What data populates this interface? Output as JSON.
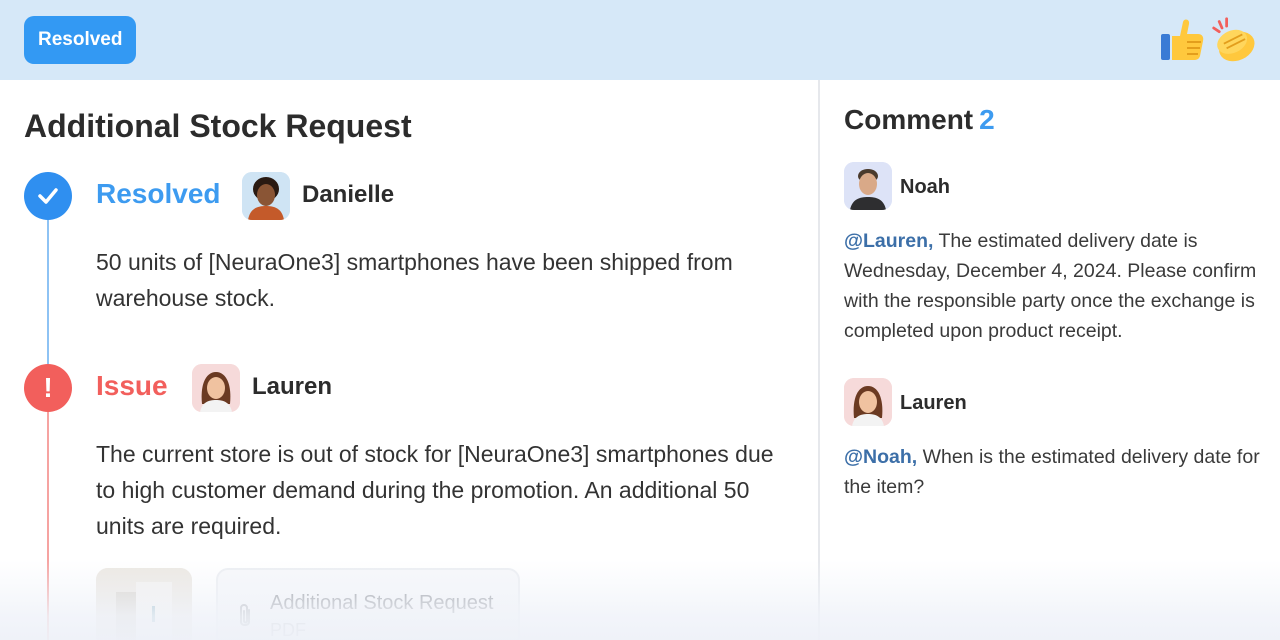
{
  "header": {
    "status_badge": "Resolved",
    "reactions": [
      "thumbs-up-icon",
      "clapping-hands-icon"
    ]
  },
  "request": {
    "title": "Additional Stock Request",
    "steps": [
      {
        "status": "Resolved",
        "user": "Danielle",
        "text": "50 units of [NeuraOne3] smartphones have been shipped from warehouse stock."
      },
      {
        "status": "Issue",
        "user": "Lauren",
        "text": "The current store is out of stock for [NeuraOne3] smartphones due to high customer demand during the promotion. An additional 50 units are required."
      }
    ],
    "attachment": {
      "name": "Additional Stock Request",
      "type": "PDF"
    }
  },
  "comments": {
    "label": "Comment",
    "count": "2",
    "items": [
      {
        "user": "Noah",
        "mention": "@Lauren,",
        "text": " The estimated delivery date is Wednesday, December 4, 2024. Please confirm with the responsible party once the exchange is completed upon product receipt."
      },
      {
        "user": "Lauren",
        "mention": "@Noah,",
        "text": " When is the estimated delivery date for the item?"
      }
    ]
  },
  "colors": {
    "accent": "#3399f3",
    "issue": "#f25f5c",
    "header_bg": "#d6e8f8",
    "mention": "#3c6fa8"
  }
}
